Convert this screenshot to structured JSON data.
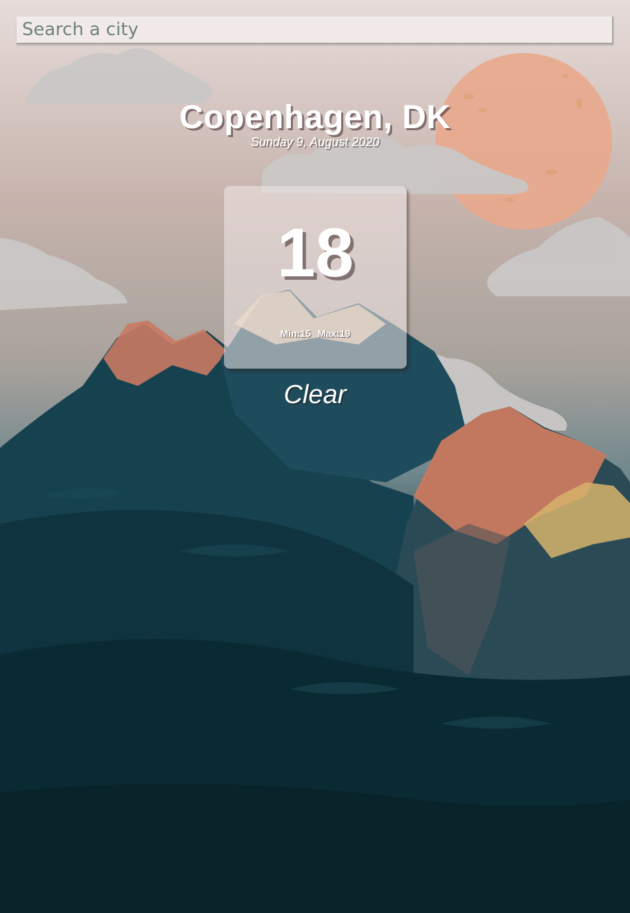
{
  "search": {
    "placeholder": "Search a city"
  },
  "location": {
    "city": "Copenhagen, DK",
    "date": "Sunday 9, August 2020"
  },
  "weather": {
    "temperature": "18",
    "min_label": "Min:15",
    "max_label": "Max:19",
    "condition": "Clear"
  },
  "colors": {
    "sky_top": "#e7dcda",
    "sun": "#e8a98c",
    "mountain_peak": "#c9785f",
    "mountain_dark": "#0e2a33",
    "text": "#ffffff"
  }
}
